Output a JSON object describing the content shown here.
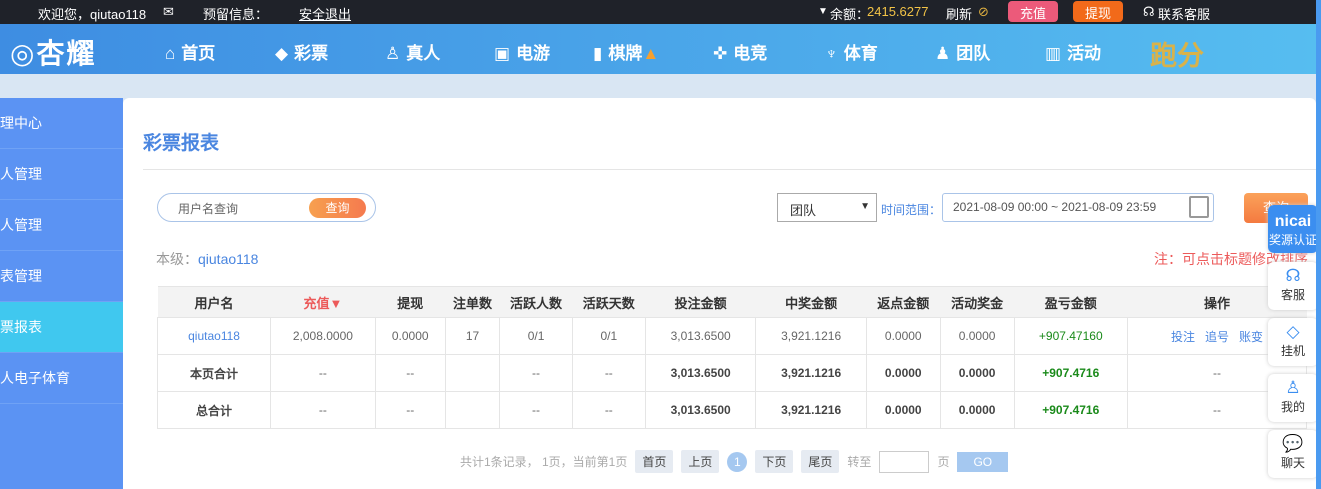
{
  "topbar": {
    "welcome": "欢迎您，qiutao118",
    "reserved": "预留信息：",
    "logout": "安全退出",
    "balance_label": "余额：",
    "balance": "2415.6277",
    "refresh": "刷新",
    "deposit": "充值",
    "withdraw": "提现",
    "support": "联系客服"
  },
  "nav": {
    "logo": "杏耀",
    "items": [
      "首页",
      "彩票",
      "真人",
      "电游",
      "棋牌",
      "电竞",
      "体育",
      "团队",
      "活动"
    ],
    "promo": "跑分"
  },
  "sidebar": [
    "理中心",
    "人管理",
    "人管理",
    "表管理",
    "票报表",
    "人电子体育"
  ],
  "main": {
    "title": "彩票报表",
    "search_placeholder": "用户名查询",
    "search_btn": "查询",
    "select": "团队",
    "time_label": "时间范围：",
    "date_range": "2021-08-09 00:00 ~ 2021-08-09 23:59",
    "query_btn": "查询",
    "level_label": "本级：",
    "level_user": "qiutao118",
    "note": "注：可点击标题修改排序"
  },
  "table": {
    "headers": [
      "用户名",
      "充值▼",
      "提现",
      "注单数",
      "活跃人数",
      "活跃天数",
      "投注金额",
      "中奖金额",
      "返点金额",
      "活动奖金",
      "盈亏金额",
      "操作"
    ],
    "rows": [
      [
        "qiutao118",
        "2,008.0000",
        "0.0000",
        "17",
        "0/1",
        "0/1",
        "3,013.6500",
        "3,921.1216",
        "0.0000",
        "0.0000",
        "+907.47160",
        ""
      ],
      [
        "本页合计",
        "--",
        "--",
        "",
        "--",
        "--",
        "3,013.6500",
        "3,921.1216",
        "0.0000",
        "0.0000",
        "+907.4716",
        "--"
      ],
      [
        "总合计",
        "--",
        "--",
        "",
        "--",
        "--",
        "3,013.6500",
        "3,921.1216",
        "0.0000",
        "0.0000",
        "+907.4716",
        "--"
      ]
    ],
    "actions": [
      "投注",
      "追号",
      "账变"
    ]
  },
  "pager": {
    "info": "共计1条记录， 1页，当前第1页",
    "first": "首页",
    "prev": "上页",
    "current": "1",
    "next": "下页",
    "last": "尾页",
    "goto": "转至",
    "page": "页",
    "go": "GO"
  },
  "float": {
    "badge_top": "nicai",
    "badge": "奖源认证",
    "items": [
      "客服",
      "挂机",
      "我的",
      "聊天"
    ]
  }
}
